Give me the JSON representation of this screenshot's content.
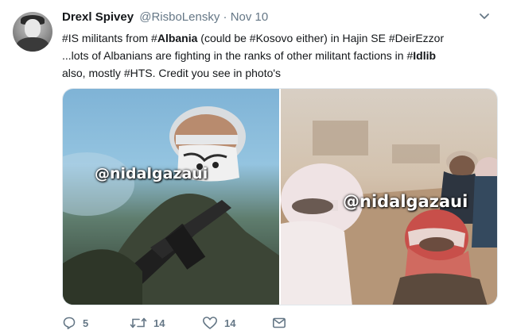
{
  "tweet": {
    "author_name": "Drexl Spivey",
    "author_handle": "@RisboLensky",
    "separator": "·",
    "timestamp": "Nov 10",
    "text": {
      "l1_tag1_hash": "#IS",
      "l1_t1": " militants from ",
      "l1_tag2_hash": "#",
      "l1_tag2_word": "Albania",
      "l1_t2": " (could be ",
      "l1_tag3": "#Kosovo",
      "l1_t3": " either)  in Hajin SE ",
      "l1_tag4": "#DeirEzzor",
      "l2_t1": "...lots of Albanians are fighting in the ranks of other militant factions in ",
      "l2_tag_hash": "#",
      "l2_tag_word": "Idlib",
      "l3_t1": "also, mostly ",
      "l3_tag": "#HTS",
      "l3_t2": ". Credit you see in photo's"
    }
  },
  "media": {
    "left_watermark": "@nidalgazaui",
    "right_watermark": "@nidalgazaui"
  },
  "actions": {
    "reply_count": "5",
    "retweet_count": "14",
    "like_count": "14"
  },
  "colors": {
    "text": "#14171a",
    "secondary": "#657786"
  },
  "icons": [
    "avatar",
    "chevron-down-icon",
    "reply-icon",
    "retweet-icon",
    "heart-icon",
    "envelope-icon"
  ]
}
